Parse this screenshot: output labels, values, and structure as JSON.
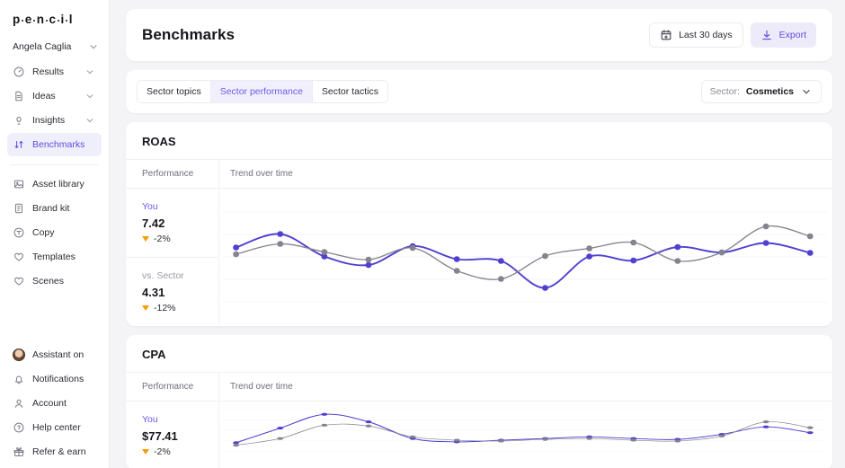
{
  "brand": {
    "logo_text": "pencil",
    "logo_letters": [
      "p",
      "e",
      "n",
      "c",
      "i",
      "l"
    ]
  },
  "sidebar": {
    "account": {
      "name": "Angela Caglia",
      "icon": "chevron-down-icon"
    },
    "nav_primary": [
      {
        "label": "Results",
        "icon": "speedometer-icon",
        "expandable": true,
        "active": false
      },
      {
        "label": "Ideas",
        "icon": "document-icon",
        "expandable": true,
        "active": false
      },
      {
        "label": "Insights",
        "icon": "lightbulb-icon",
        "expandable": true,
        "active": false
      },
      {
        "label": "Benchmarks",
        "icon": "sort-arrows-icon",
        "expandable": false,
        "active": true
      }
    ],
    "nav_secondary": [
      {
        "label": "Asset library",
        "icon": "image-icon"
      },
      {
        "label": "Brand kit",
        "icon": "brandkit-icon"
      },
      {
        "label": "Copy",
        "icon": "copy-icon"
      },
      {
        "label": "Templates",
        "icon": "heart-icon"
      },
      {
        "label": "Scenes",
        "icon": "heart-icon"
      }
    ],
    "nav_bottom": [
      {
        "label": "Assistant on",
        "icon": "avatar-icon"
      },
      {
        "label": "Notifications",
        "icon": "bell-icon"
      },
      {
        "label": "Account",
        "icon": "user-icon"
      },
      {
        "label": "Help center",
        "icon": "question-circle-icon"
      },
      {
        "label": "Refer & earn",
        "icon": "gift-icon"
      }
    ]
  },
  "header": {
    "title": "Benchmarks",
    "date_range_button": {
      "label": "Last 30 days",
      "icon": "calendar-icon"
    },
    "export_button": {
      "label": "Export",
      "icon": "download-icon"
    }
  },
  "tabs": [
    {
      "label": "Sector topics",
      "active": false
    },
    {
      "label": "Sector performance",
      "active": true
    },
    {
      "label": "Sector tactics",
      "active": false
    }
  ],
  "sector_selector": {
    "label": "Sector:",
    "value": "Cosmetics",
    "icon": "chevron-down-icon"
  },
  "columns": {
    "performance": "Performance",
    "trend": "Trend over time"
  },
  "colors": {
    "accent_purple": "#5b4ee0",
    "line_you": "#4f41cf",
    "line_sector": "#84848f",
    "delta_negative": "#f59e0b",
    "tab_active_bg": "#f1effc",
    "nav_active_bg": "#efeefb",
    "page_bg": "#f4f4f7",
    "card_bg": "#ffffff",
    "grid_line": "#f5f5f8"
  },
  "metrics": [
    {
      "title": "ROAS",
      "stats": [
        {
          "label": "You",
          "value": "7.42",
          "delta": "-2%",
          "direction": "down"
        },
        {
          "label": "vs. Sector",
          "value": "4.31",
          "delta": "-12%",
          "direction": "down"
        }
      ]
    },
    {
      "title": "CPA",
      "stats": [
        {
          "label": "You",
          "value": "$77.41",
          "delta": "-2%",
          "direction": "down"
        }
      ]
    }
  ],
  "chart_data": [
    {
      "type": "line",
      "title": "ROAS",
      "subtitle": "Trend over time",
      "xlabel": "",
      "ylabel": "",
      "grid": true,
      "legend": [
        "You",
        "vs. Sector"
      ],
      "legend_position": "left-column",
      "x": [
        0,
        1,
        2,
        3,
        4,
        5,
        6,
        7,
        8,
        9,
        10,
        11,
        12,
        13
      ],
      "ylim": [
        0,
        10
      ],
      "series": [
        {
          "name": "You",
          "color": "#4f41cf",
          "values": [
            6.05,
            7.55,
            5.05,
            4.1,
            6.2,
            4.75,
            4.55,
            1.55,
            5.05,
            4.6,
            6.1,
            5.5,
            6.55,
            5.45
          ]
        },
        {
          "name": "vs. Sector",
          "color": "#84848f",
          "values": [
            5.3,
            6.45,
            5.55,
            4.7,
            6.0,
            3.45,
            2.55,
            5.1,
            5.95,
            6.6,
            4.55,
            5.5,
            8.4,
            7.3
          ]
        }
      ]
    },
    {
      "type": "line",
      "title": "CPA",
      "subtitle": "Trend over time",
      "xlabel": "",
      "ylabel": "",
      "grid": true,
      "legend": [
        "You",
        "vs. Sector"
      ],
      "legend_position": "left-column",
      "x": [
        0,
        1,
        2,
        3,
        4,
        5,
        6,
        7,
        8,
        9,
        10,
        11,
        12,
        13
      ],
      "ylim": [
        0,
        100
      ],
      "series": [
        {
          "name": "You",
          "color": "#4f41cf",
          "values": [
            20,
            55,
            88,
            70,
            30,
            22,
            26,
            30,
            34,
            30,
            28,
            40,
            58,
            44
          ]
        },
        {
          "name": "vs. Sector",
          "color": "#84848f",
          "values": [
            14,
            30,
            62,
            60,
            34,
            26,
            24,
            28,
            30,
            26,
            24,
            36,
            70,
            56
          ]
        }
      ]
    }
  ]
}
